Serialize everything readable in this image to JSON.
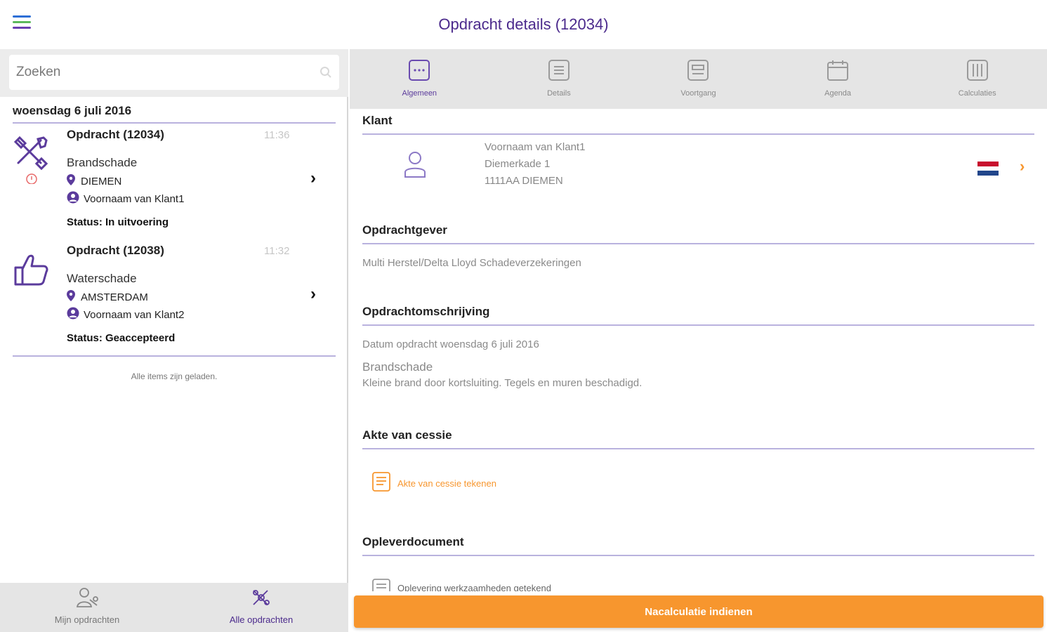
{
  "header": {
    "title": "Opdracht details (12034)"
  },
  "colors": {
    "accent_purple": "#4b2a8c",
    "accent_orange": "#f7962e",
    "divider": "#b9b2de",
    "menu_blue": "#2e6fd6",
    "menu_green": "#5cb85c",
    "menu_purple": "#6a3fb0"
  },
  "search": {
    "placeholder": "Zoeken"
  },
  "job_list": {
    "date": "woensdag 6 juli 2016",
    "items": [
      {
        "title": "Opdracht (12034)",
        "time": "11:36",
        "type": "Brandschade",
        "location": "DIEMEN",
        "client": "Voornaam van Klant1",
        "status": "Status: In uitvoering",
        "icon": "tools-icon"
      },
      {
        "title": "Opdracht (12038)",
        "time": "11:32",
        "type": "Waterschade",
        "location": "AMSTERDAM",
        "client": "Voornaam van Klant2",
        "status": "Status: Geaccepteerd",
        "icon": "thumbs-up-icon"
      }
    ],
    "loaded_text": "Alle items zijn geladen."
  },
  "bottom_nav": {
    "items": [
      {
        "label": "Mijn opdrachten",
        "icon": "user-tools-icon"
      },
      {
        "label": "Alle opdrachten",
        "icon": "tools-group-icon"
      }
    ]
  },
  "tabs": [
    {
      "label": "Algemeen",
      "icon": "chat-icon"
    },
    {
      "label": "Details",
      "icon": "list-icon"
    },
    {
      "label": "Voortgang",
      "icon": "progress-icon"
    },
    {
      "label": "Agenda",
      "icon": "calendar-icon"
    },
    {
      "label": "Calculaties",
      "icon": "calculator-icon"
    }
  ],
  "klant": {
    "title": "Klant",
    "name": "Voornaam van Klant1",
    "street": "Diemerkade 1",
    "city": "1111AA DIEMEN"
  },
  "opdrachtgever": {
    "title": "Opdrachtgever",
    "value": "Multi Herstel/Delta Lloyd Schadeverzekeringen"
  },
  "omschrijving": {
    "title": "Opdrachtomschrijving",
    "date_line": "Datum opdracht woensdag 6 juli 2016",
    "type": "Brandschade",
    "description": "Kleine brand door kortsluiting. Tegels en muren beschadigd."
  },
  "akte": {
    "title": "Akte van cessie",
    "action": "Akte van cessie tekenen"
  },
  "oplever": {
    "title": "Opleverdocument",
    "action": "Oplevering werkzaamheden getekend"
  },
  "submit": {
    "label": "Nacalculatie indienen"
  }
}
